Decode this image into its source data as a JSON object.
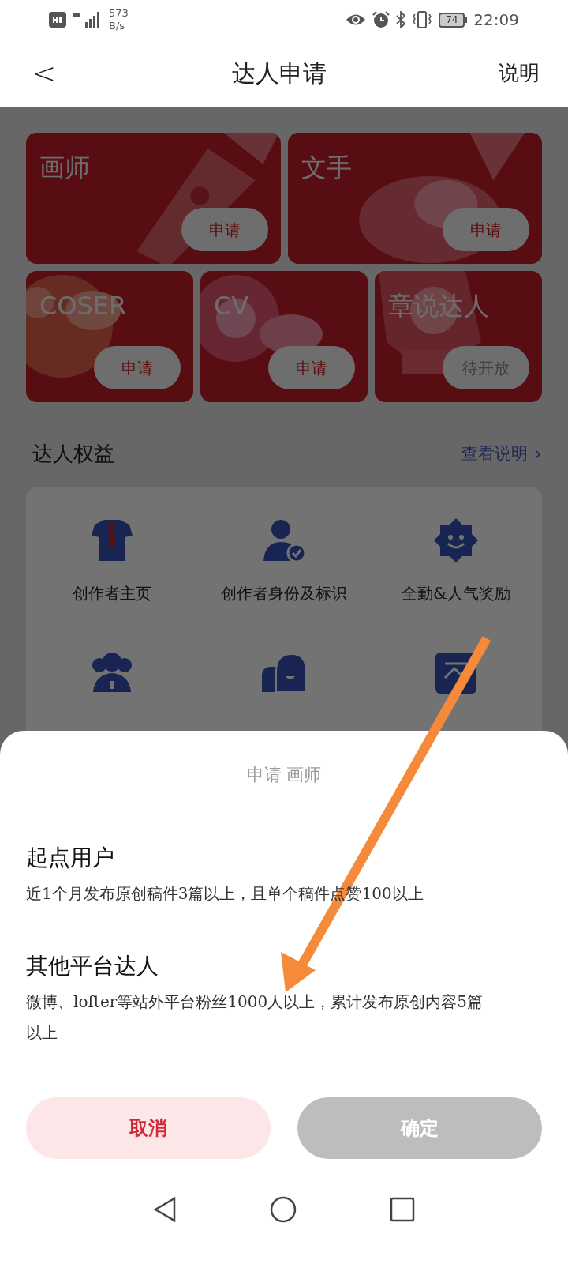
{
  "status_bar": {
    "speed_value": "573",
    "speed_unit": "B/s",
    "battery": "74",
    "time": "22:09"
  },
  "header": {
    "back": "<",
    "title": "达人申请",
    "action": "说明"
  },
  "cards": [
    {
      "title": "画师",
      "button": "申请",
      "disabled": false
    },
    {
      "title": "文手",
      "button": "申请",
      "disabled": false
    },
    {
      "title": "COSER",
      "button": "申请",
      "disabled": false
    },
    {
      "title": "CV",
      "button": "申请",
      "disabled": false
    },
    {
      "title": "章说达人",
      "button": "待开放",
      "disabled": true
    }
  ],
  "benefits_section": {
    "title": "达人权益",
    "link": "查看说明",
    "link_arrow": "›"
  },
  "benefits": [
    {
      "label": "创作者主页"
    },
    {
      "label": "创作者身份及标识"
    },
    {
      "label": "全勤&人气奖励"
    }
  ],
  "sheet": {
    "title": "申请 画师",
    "options": [
      {
        "title": "起点用户",
        "description": "近1个月发布原创稿件3篇以上，且单个稿件点赞100以上"
      },
      {
        "title": "其他平台达人",
        "description": "微博、lofter等站外平台粉丝1000人以上，累计发布原创内容5篇以上"
      }
    ],
    "buttons": [
      {
        "label": "取消",
        "kind": "cancel",
        "disabled": false
      },
      {
        "label": "确定",
        "kind": "confirm",
        "disabled": true
      }
    ]
  }
}
